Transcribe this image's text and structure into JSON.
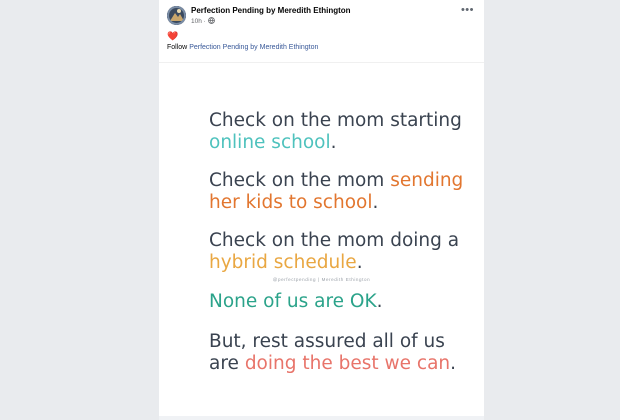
{
  "post": {
    "page_name": "Perfection Pending by Meredith Ethington",
    "time": "10h ·",
    "audience_icon": "globe-icon",
    "more_icon": "more-options-icon",
    "reaction": "❤️",
    "follow_prefix": "Follow",
    "follow_link": "Perfection Pending by Meredith Ethington"
  },
  "image_text": {
    "block1": {
      "line1": "Check on the mom starting",
      "line2_highlight": "online school",
      "line2_end": "."
    },
    "block2": {
      "line1_start": "Check on the mom ",
      "line1_highlight": "sending",
      "line2_highlight": "her kids to school",
      "line2_end": "."
    },
    "block3": {
      "line1": "Check on the mom doing a",
      "line2_highlight": "hybrid schedule",
      "line2_end": "."
    },
    "watermark": "@perfectpending | Meredith Ethington",
    "block4": {
      "highlight": "None of us are OK",
      "end": "."
    },
    "block5": {
      "line1": "But, rest assured all of us",
      "line2_start": "are ",
      "line2_highlight": "doing the best we can",
      "line2_end": "."
    }
  },
  "colors": {
    "teal": "#4ec2bd",
    "orange": "#e2762f",
    "gold": "#e9a742",
    "green": "#2ba38a",
    "coral": "#e8746a",
    "link": "#385898"
  }
}
